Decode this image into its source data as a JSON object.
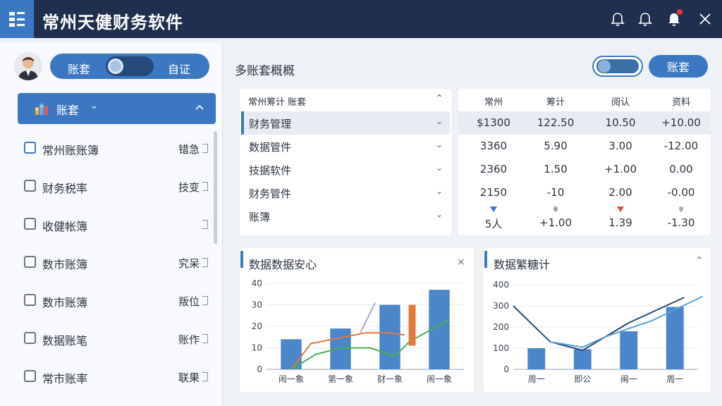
{
  "app": {
    "title": "常州天健财务软件"
  },
  "sidebar": {
    "switch_left": "账套",
    "switch_right": "自证",
    "account_header": "账套",
    "items": [
      {
        "label": "常州账账簿",
        "right": "错急",
        "active": true
      },
      {
        "label": "财务税率",
        "right": "技变",
        "active": false
      },
      {
        "label": "收健帐簿",
        "right": "",
        "active": false
      },
      {
        "label": "数市账簿",
        "right": "究呆",
        "active": false
      },
      {
        "label": "数市账簿",
        "right": "叛位",
        "active": false
      },
      {
        "label": "数据账笔",
        "right": "账作",
        "active": false
      },
      {
        "label": "常市账率",
        "right": "联果",
        "active": false
      }
    ]
  },
  "main": {
    "title": "多账套概概",
    "button_label": "账套",
    "left_table": {
      "header": "常州筹计  账套",
      "rows": [
        "财务管理",
        "数据管件",
        "技据软件",
        "财务管件",
        "账簿"
      ]
    },
    "right_table": {
      "headers": [
        "常州",
        "筹计",
        "阅认",
        "资料"
      ],
      "rows": [
        [
          "$1300",
          "122.50",
          "10.50",
          "+10.00"
        ],
        [
          "3360",
          "5.90",
          "3.00",
          "-12.00"
        ],
        [
          "2360",
          "1.50",
          "+1.00",
          "0.00"
        ],
        [
          "2150",
          "-10",
          "2.00",
          "-0.00"
        ],
        [
          "5人",
          "+1.00",
          "1.39",
          "-1.30"
        ]
      ],
      "marker_colors": [
        "#3c78c2",
        "#9aa3ad",
        "#e04848",
        "#a9b0b8"
      ]
    }
  },
  "colors": {
    "titlebar": "#1f2f4d",
    "accent": "#3c78c2",
    "bar_blue": "#4a86c8",
    "line_orange": "#e07840",
    "line_green": "#4caf50",
    "line_steel": "#a4b4c8",
    "line_dark": "#2a4a7a",
    "line_light": "#5aa0d0"
  },
  "charts": [
    {
      "title": "数据数据安心",
      "chart_data": {
        "type": "bar",
        "categories": [
          "闹一象",
          "第一象",
          "财一象",
          "闹一象"
        ],
        "yticks": [
          "0",
          "10",
          "20",
          "30",
          "40"
        ],
        "ylim": [
          0,
          40
        ],
        "series": [
          {
            "values": [
              14,
              19,
              30,
              37
            ],
            "type": "bar"
          },
          {
            "values": [
              0,
              12,
              17,
              17,
              16
            ],
            "type": "line",
            "x": [
              0,
              0.4,
              1.5,
              2.0,
              2.3
            ]
          },
          {
            "values": [
              0,
              7,
              10,
              10,
              6,
              13,
              23
            ],
            "type": "line",
            "x": [
              0,
              0.5,
              1.0,
              1.6,
              2.1,
              2.4,
              3.2
            ]
          },
          {
            "values": [
              17,
              31
            ],
            "type": "line",
            "x": [
              1.4,
              1.7
            ]
          }
        ],
        "highlight_bar": {
          "from": 11,
          "to": 30,
          "x": 2.45
        }
      }
    },
    {
      "title": "数据繁糖计",
      "chart_data": {
        "type": "bar",
        "categories": [
          "周一",
          "即公",
          "闽一",
          "周一"
        ],
        "yticks": [
          "0",
          "100",
          "200",
          "300",
          "400"
        ],
        "ylim": [
          0,
          400
        ],
        "series": [
          {
            "values": [
              100,
              95,
              180,
              295
            ],
            "type": "bar"
          },
          {
            "values": [
              300,
              130,
              90,
              220,
              340
            ],
            "type": "line",
            "x": [
              -0.5,
              0.3,
              1.0,
              2.0,
              3.2
            ]
          },
          {
            "values": [
              130,
              105,
              155,
              230,
              345
            ],
            "type": "line",
            "x": [
              0.3,
              1.0,
              1.5,
              2.5,
              3.6
            ]
          }
        ]
      }
    }
  ]
}
